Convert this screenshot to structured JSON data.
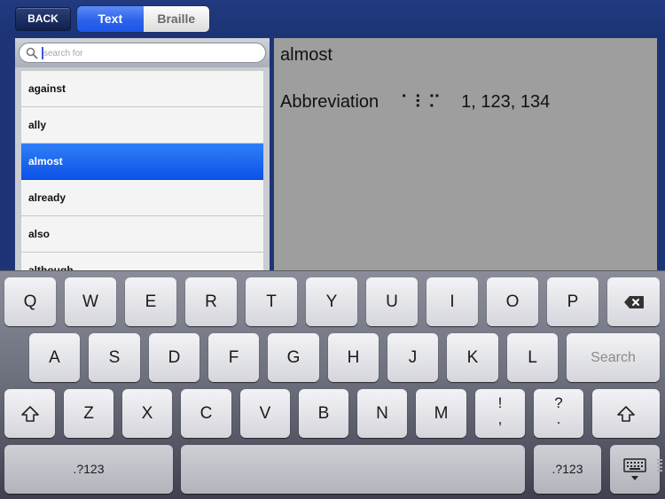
{
  "header": {
    "back_label": "BACK",
    "segments": [
      {
        "label": "Text",
        "active": true
      },
      {
        "label": "Braille",
        "active": false
      }
    ]
  },
  "search": {
    "placeholder": "search for",
    "value": ""
  },
  "word_list": {
    "items": [
      {
        "label": "against",
        "selected": false
      },
      {
        "label": "ally",
        "selected": false
      },
      {
        "label": "almost",
        "selected": true
      },
      {
        "label": "already",
        "selected": false
      },
      {
        "label": "also",
        "selected": false
      },
      {
        "label": "although",
        "selected": false
      }
    ]
  },
  "detail": {
    "word": "almost",
    "type_label": "Abbreviation",
    "braille_cells": "⠁⠇⠍",
    "dot_numbers": "1, 123, 134"
  },
  "keyboard": {
    "row1": [
      "Q",
      "W",
      "E",
      "R",
      "T",
      "Y",
      "U",
      "I",
      "O",
      "P"
    ],
    "row2": [
      "A",
      "S",
      "D",
      "F",
      "G",
      "H",
      "J",
      "K",
      "L"
    ],
    "row3": [
      "Z",
      "X",
      "C",
      "V",
      "B",
      "N",
      "M"
    ],
    "search_label": "Search",
    "punct1": {
      "top": "!",
      "bottom": ","
    },
    "punct2": {
      "top": "?",
      "bottom": "."
    },
    "numbers_label": ".?123",
    "icons": {
      "backspace": "backspace-icon",
      "shift": "shift-icon",
      "dismiss": "keyboard-dismiss-icon"
    }
  },
  "colors": {
    "background": "#1d3577",
    "selected_row": "#1a66f0",
    "detail_panel": "#9e9e9e"
  }
}
